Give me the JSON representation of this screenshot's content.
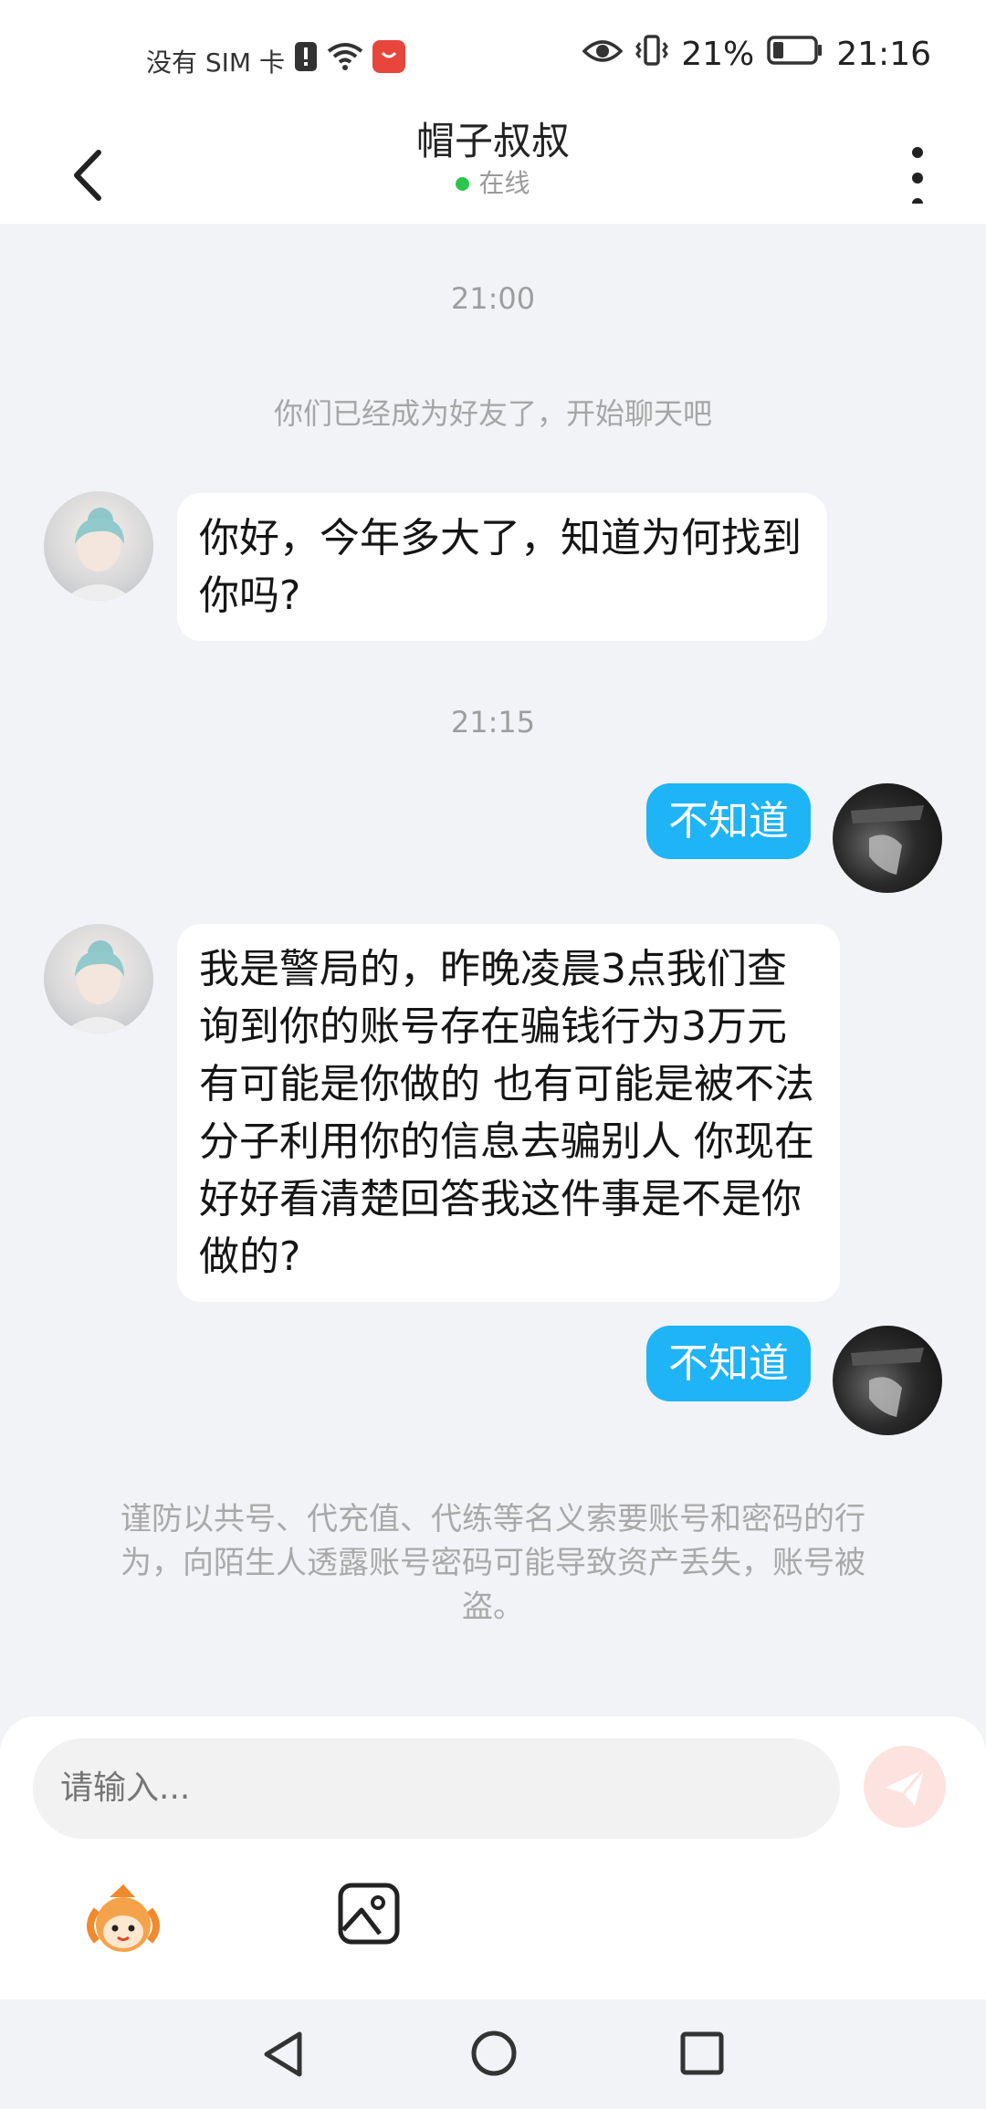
{
  "status_bar": {
    "carrier": "没有 SIM 卡",
    "battery": "21%",
    "time": "21:16"
  },
  "header": {
    "title": "帽子叔叔",
    "status": "在线",
    "colors": {
      "online_dot": "#2ac84a"
    }
  },
  "chat": {
    "time_1": "21:00",
    "system_note": "你们已经成为好友了，开始聊天吧",
    "msg_1": "你好，今年多大了，知道为何找到你吗?",
    "time_2": "21:15",
    "msg_2": "不知道",
    "msg_3": "我是警局的，昨晚凌晨3点我们查询到你的账号存在骗钱行为3万元 有可能是你做的 也有可能是被不法分子利用你的信息去骗别人 你现在好好看清楚回答我这件事是不是你做的?",
    "msg_4": "不知道",
    "warning": "谨防以共号、代充值、代练等名义索要账号和密码的行为，向陌生人透露账号密码可能导致资产丢失，账号被盗。",
    "colors": {
      "sent_bubble": "#1fb4f5",
      "received_bubble": "#ffffff"
    }
  },
  "composer": {
    "placeholder": "请输入..."
  },
  "icons": {
    "back": "back-arrow-icon",
    "more": "more-vertical-icon",
    "send": "send-icon",
    "emoji": "emoji-character-icon",
    "image": "image-icon"
  }
}
